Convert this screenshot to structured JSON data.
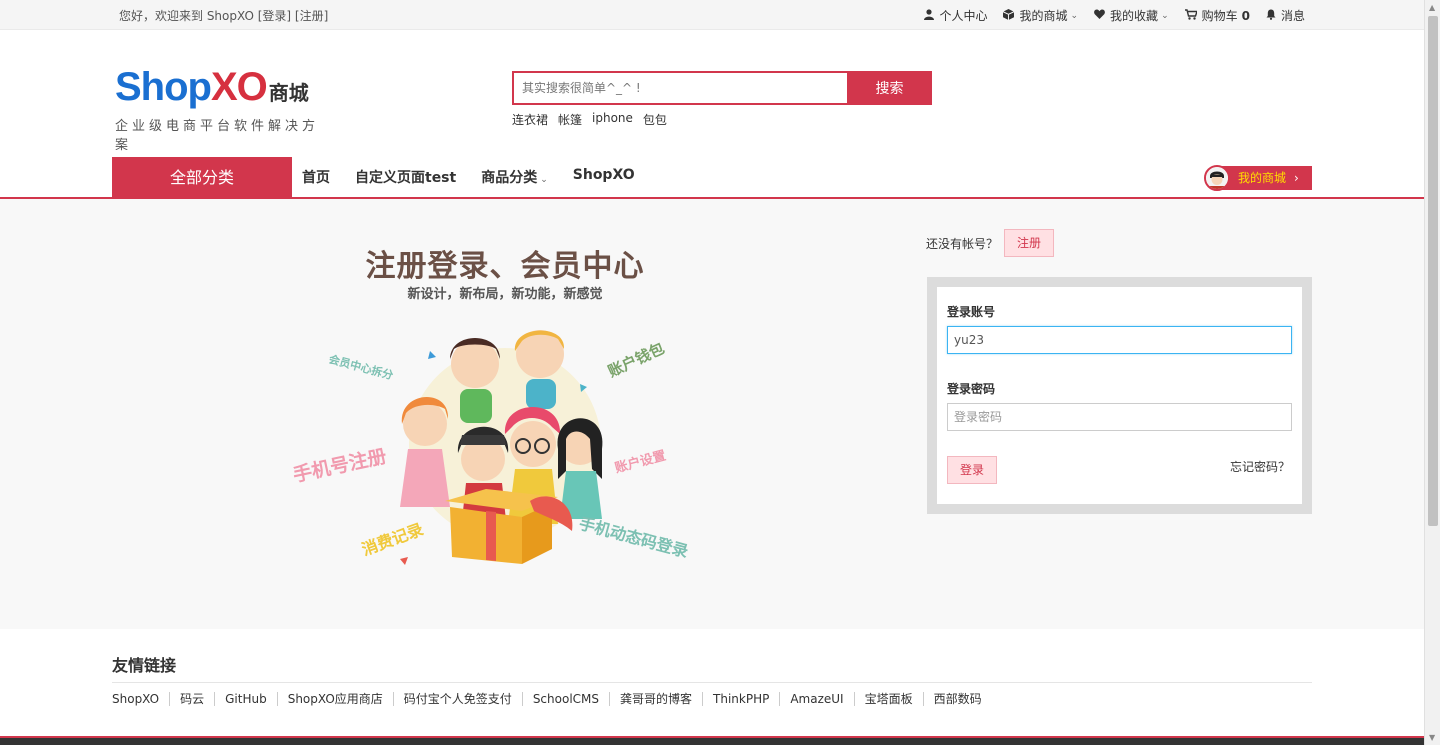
{
  "topbar": {
    "welcome_prefix": "您好，欢迎来到 ShopXO ",
    "login_link": "[登录]",
    "register_link": "[注册]",
    "items": [
      {
        "icon": "user-icon",
        "label": "个人中心"
      },
      {
        "icon": "cube-icon",
        "label": "我的商城"
      },
      {
        "icon": "heart-icon",
        "label": "我的收藏"
      },
      {
        "icon": "cart-icon",
        "label": "购物车",
        "count": "0"
      },
      {
        "icon": "bell-icon",
        "label": "消息"
      }
    ]
  },
  "header": {
    "logo_shop": "Shop",
    "logo_xo": "XO",
    "logo_mall": "商城",
    "logo_tagline": "企业级电商平台软件解决方案",
    "search_placeholder": "其实搜索很简单^_^ !",
    "search_button": "搜索",
    "hot_words": [
      "连衣裙",
      "帐篷",
      "iphone",
      "包包"
    ]
  },
  "nav": {
    "all_categories": "全部分类",
    "links": [
      "首页",
      "自定义页面test",
      "商品分类",
      "ShopXO"
    ],
    "my_mall": "我的商城"
  },
  "promo": {
    "title": "注册登录、会员中心",
    "subtitle": "新设计，新布局，新功能，新感觉",
    "labels": [
      "会员中心拆分",
      "账户钱包",
      "手机号注册",
      "账户设置",
      "消费记录",
      "手机动态码登录"
    ]
  },
  "login": {
    "no_account": "还没有帐号？",
    "register_button": "注册",
    "account_label": "登录账号",
    "account_value": "yu23",
    "password_label": "登录密码",
    "password_placeholder": "登录密码",
    "login_button": "登录",
    "forgot_password": "忘记密码？"
  },
  "friends": {
    "title": "友情链接",
    "links": [
      "ShopXO",
      "码云",
      "GitHub",
      "ShopXO应用商店",
      "码付宝个人免签支付",
      "SchoolCMS",
      "龚哥哥的博客",
      "ThinkPHP",
      "AmazeUI",
      "宝塔面板",
      "西部数码"
    ]
  },
  "colors": {
    "accent": "#d2364c",
    "brand_blue": "#1a6fd1",
    "brand_red": "#d6303f"
  }
}
